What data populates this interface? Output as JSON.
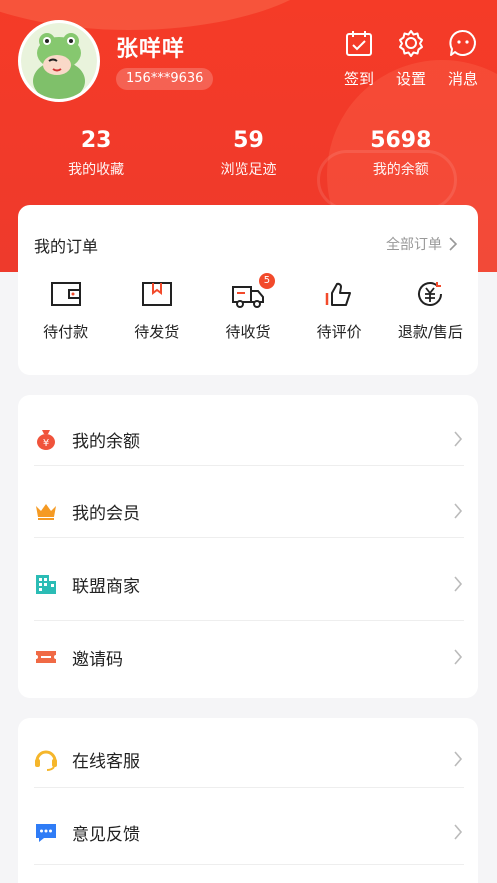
{
  "profile": {
    "name": "张咩咩",
    "phone": "156***9636"
  },
  "top_actions": [
    {
      "label": "签到",
      "icon": "calendar-check-icon"
    },
    {
      "label": "设置",
      "icon": "gear-icon"
    },
    {
      "label": "消息",
      "icon": "message-icon"
    }
  ],
  "stats": [
    {
      "value": "23",
      "label": "我的收藏"
    },
    {
      "value": "59",
      "label": "浏览足迹"
    },
    {
      "value": "5698",
      "label": "我的余额"
    }
  ],
  "orders": {
    "title": "我的订单",
    "all_label": "全部订单",
    "items": [
      {
        "label": "待付款",
        "icon": "wallet-icon"
      },
      {
        "label": "待发货",
        "icon": "box-icon"
      },
      {
        "label": "待收货",
        "icon": "truck-icon",
        "badge": "5"
      },
      {
        "label": "待评价",
        "icon": "thumbs-up-icon"
      },
      {
        "label": "退款/售后",
        "icon": "refund-icon"
      }
    ]
  },
  "menu1": [
    {
      "label": "我的余额",
      "icon": "money-bag-icon",
      "color": "#f0533b"
    },
    {
      "label": "我的会员",
      "icon": "crown-icon",
      "color": "#f59a23"
    },
    {
      "label": "联盟商家",
      "icon": "building-icon",
      "color": "#2bbcb5"
    },
    {
      "label": "邀请码",
      "icon": "ticket-icon",
      "color": "#f06a45"
    }
  ],
  "menu2": [
    {
      "label": "在线客服",
      "icon": "headset-icon",
      "color": "#f5b62b"
    },
    {
      "label": "意见反馈",
      "icon": "chat-bubble-icon",
      "color": "#2f7cf6"
    }
  ],
  "colors": {
    "brand": "#f13a2a",
    "badge": "#f24a2b"
  }
}
